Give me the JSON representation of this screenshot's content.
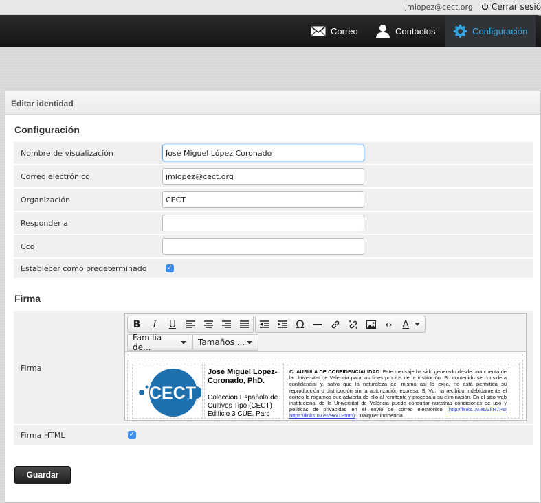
{
  "topbar": {
    "user_email": "jmlopez@cect.org",
    "logout_label": "Cerrar sesión"
  },
  "nav": {
    "items": [
      {
        "label": "Correo",
        "icon": "envelope-icon"
      },
      {
        "label": "Contactos",
        "icon": "person-icon"
      },
      {
        "label": "Configuración",
        "icon": "gear-icon",
        "active": true
      }
    ],
    "active_color": "#34a3e0"
  },
  "panel": {
    "title": "Editar identidad"
  },
  "config": {
    "section_title": "Configuración",
    "fields": {
      "display_name": {
        "label": "Nombre de visualización",
        "value": "José Miguel López Coronado"
      },
      "email": {
        "label": "Correo electrónico",
        "value": "jmlopez@cect.org"
      },
      "organization": {
        "label": "Organización",
        "value": "CECT"
      },
      "reply_to": {
        "label": "Responder a",
        "value": ""
      },
      "bcc": {
        "label": "Cco",
        "value": ""
      },
      "default": {
        "label": "Establecer como predeterminado",
        "checked": true
      }
    }
  },
  "signature": {
    "section_title": "Firma",
    "label": "Firma",
    "html_label": "Firma HTML",
    "html_checked": true,
    "font_family_placeholder": "Familia de...",
    "font_size_placeholder": "Tamaños ...",
    "logo_text": "CECT",
    "name": "Jose Miguel Lopez-Coronado, PhD.",
    "org": "Coleccion Española de Cultivos Tipo (CECT) Edificio 3 CUE. Parc",
    "clause_title": "CLÁUSULA DE CONFIDENCIALIDAD",
    "clause_text": ": Este mensaje ha sido generado desde una cuenta de la Universitat de València para los fines propios de la institución. Su contenido se considera confidencial y, salvo que la naturaleza del mismo así lo exija, no está permitida su reproducción o distribución sin la autorización expresa. Si Vd. ha recibido indebidamente el correo le rogamos que advierta de ello al remitente y proceda a su eliminación. En el sitio web institucional de la Universitat de València puede consultar nuestras condiciones de uso y políticas de privacidad en el envío de correo electrónico",
    "link1": "(http://links.uv.es/ZkR7PsI",
    "link2": "https://links.uv.es/9xxTPmm)",
    "clause_tail": "Cualquier incidencia"
  },
  "actions": {
    "save_label": "Guardar"
  }
}
